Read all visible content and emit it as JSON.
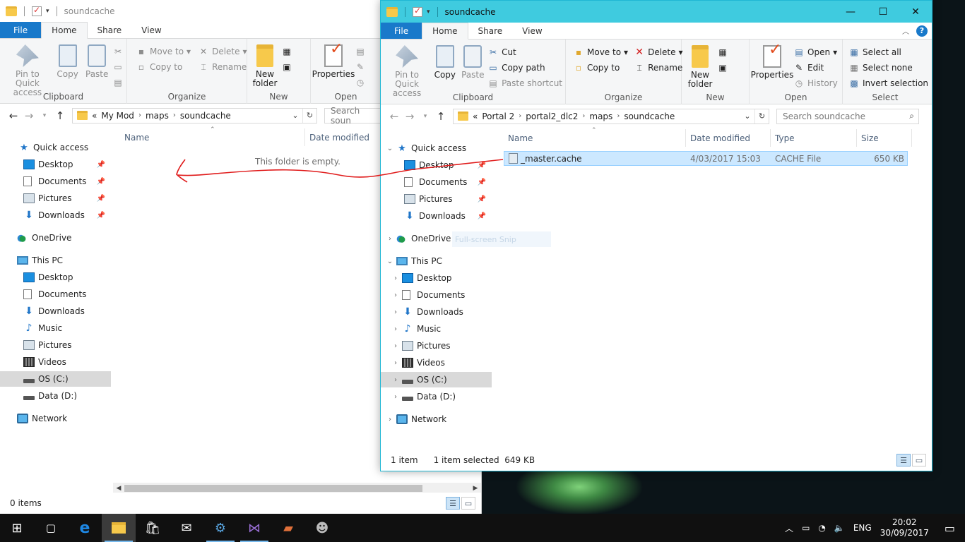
{
  "win1": {
    "title": "soundcache",
    "tabs": [
      "File",
      "Home",
      "Share",
      "View"
    ],
    "ribbon": {
      "pin_label": "Pin to Quick access",
      "copy_label": "Copy",
      "paste_label": "Paste",
      "clipboard_group": "Clipboard",
      "move_to": "Move to",
      "copy_to": "Copy to",
      "delete": "Delete",
      "rename": "Rename",
      "organize_group": "Organize",
      "new_folder": "New folder",
      "new_group": "New",
      "properties": "Properties",
      "open_group": "Open"
    },
    "breadcrumb": [
      "My Mod",
      "maps",
      "soundcache"
    ],
    "breadcrumb_prefix": "«",
    "search_placeholder": "Search soun",
    "columns": {
      "name": "Name",
      "date": "Date modified"
    },
    "empty_message": "This folder is empty.",
    "status": "0 items",
    "nav": {
      "quick_access": "Quick access",
      "qa_items": [
        "Desktop",
        "Documents",
        "Pictures",
        "Downloads"
      ],
      "onedrive": "OneDrive",
      "this_pc": "This PC",
      "pc_items": [
        "Desktop",
        "Documents",
        "Downloads",
        "Music",
        "Pictures",
        "Videos",
        "OS (C:)",
        "Data (D:)"
      ],
      "network": "Network"
    }
  },
  "win2": {
    "title": "soundcache",
    "tabs": [
      "File",
      "Home",
      "Share",
      "View"
    ],
    "ribbon": {
      "pin_label": "Pin to Quick access",
      "copy_label": "Copy",
      "paste_label": "Paste",
      "cut": "Cut",
      "copy_path": "Copy path",
      "paste_shortcut": "Paste shortcut",
      "clipboard_group": "Clipboard",
      "move_to": "Move to",
      "copy_to": "Copy to",
      "delete": "Delete",
      "rename": "Rename",
      "organize_group": "Organize",
      "new_folder": "New folder",
      "new_group": "New",
      "properties": "Properties",
      "open": "Open",
      "edit": "Edit",
      "history": "History",
      "open_group": "Open",
      "select_all": "Select all",
      "select_none": "Select none",
      "invert_selection": "Invert selection",
      "select_group": "Select"
    },
    "breadcrumb": [
      "Portal 2",
      "portal2_dlc2",
      "maps",
      "soundcache"
    ],
    "breadcrumb_prefix": "«",
    "search_placeholder": "Search soundcache",
    "columns": {
      "name": "Name",
      "date": "Date modified",
      "type": "Type",
      "size": "Size"
    },
    "files": [
      {
        "name": "_master.cache",
        "date": "4/03/2017 15:03",
        "type": "CACHE File",
        "size": "650 KB"
      }
    ],
    "status": {
      "count": "1 item",
      "selected": "1 item selected",
      "size": "649 KB"
    },
    "snip_ghost": "Full-screen Snip",
    "nav": {
      "quick_access": "Quick access",
      "qa_items": [
        "Desktop",
        "Documents",
        "Pictures",
        "Downloads"
      ],
      "onedrive": "OneDrive",
      "this_pc": "This PC",
      "pc_items": [
        "Desktop",
        "Documents",
        "Downloads",
        "Music",
        "Pictures",
        "Videos",
        "OS (C:)",
        "Data (D:)"
      ],
      "network": "Network"
    }
  },
  "taskbar": {
    "language": "ENG",
    "time": "20:02",
    "date": "30/09/2017"
  },
  "colors": {
    "accent": "#1979ca",
    "titlebar_active": "#3fcbdf",
    "selection": "#cce8ff",
    "annotation": "#e01b1b"
  }
}
